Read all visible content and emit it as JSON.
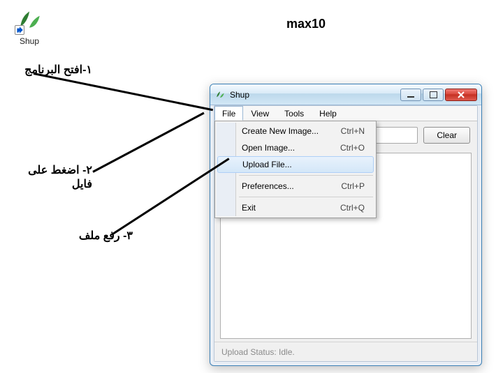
{
  "desktop_icon": {
    "label": "Shup"
  },
  "watermark": "max10",
  "annotations": {
    "step1": "١-افتح البرنامج",
    "step2": "٢- اضغط على فايل",
    "step3": "٣- رفع ملف"
  },
  "window": {
    "title": "Shup",
    "menubar": [
      "File",
      "View",
      "Tools",
      "Help"
    ],
    "open_menu_index": 0,
    "clear_button": "Clear",
    "status": "Upload Status:  Idle."
  },
  "file_menu": {
    "items": [
      {
        "label": "Create New Image...",
        "shortcut": "Ctrl+N"
      },
      {
        "label": "Open Image...",
        "shortcut": "Ctrl+O"
      },
      {
        "label": "Upload File...",
        "shortcut": ""
      },
      {
        "separator": true
      },
      {
        "label": "Preferences...",
        "shortcut": "Ctrl+P"
      },
      {
        "separator": true
      },
      {
        "label": "Exit",
        "shortcut": "Ctrl+Q"
      }
    ],
    "highlighted_index": 2
  }
}
